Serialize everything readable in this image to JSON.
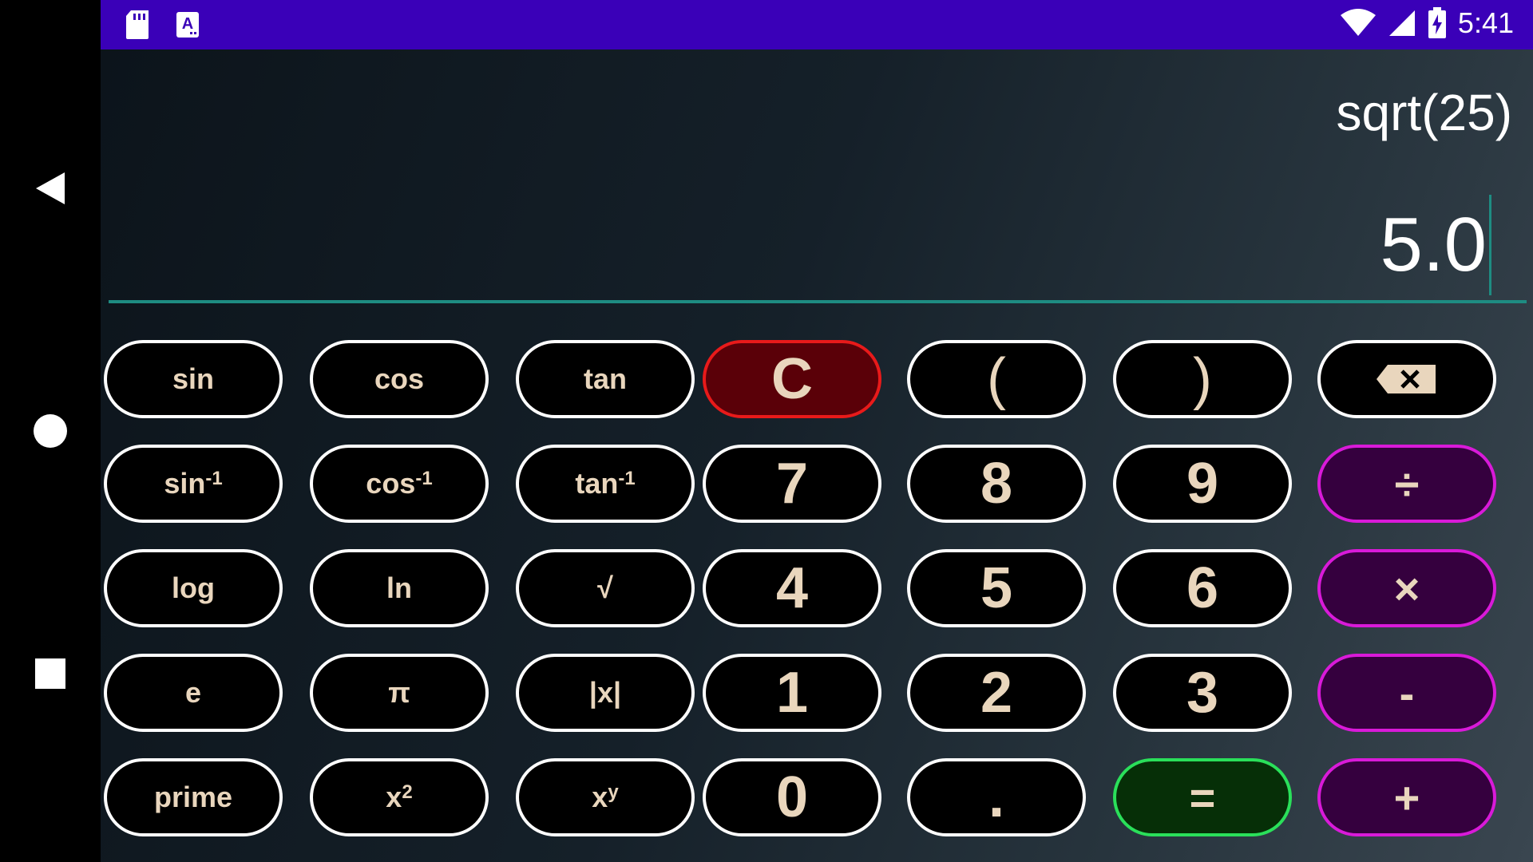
{
  "status_bar": {
    "time": "5:41",
    "icons": [
      "sd-card-icon",
      "keyboard-a-icon",
      "wifi-icon",
      "cell-signal-icon",
      "battery-charging-icon"
    ],
    "color": "#3a00b8"
  },
  "nav": {
    "icons": [
      "back-triangle-icon",
      "home-circle-icon",
      "recents-square-icon"
    ]
  },
  "display": {
    "expression": "sqrt(25)",
    "result": "5.0",
    "accent": "#1e8c82"
  },
  "keys": {
    "sin": "sin",
    "cos": "cos",
    "tan": "tan",
    "clear": "C",
    "lparen": "(",
    "rparen": ")",
    "backspace": "⌫",
    "asin": "sin",
    "asin_sup": "-1",
    "acos": "cos",
    "acos_sup": "-1",
    "atan": "tan",
    "atan_sup": "-1",
    "seven": "7",
    "eight": "8",
    "nine": "9",
    "divide": "÷",
    "log": "log",
    "ln": "ln",
    "sqrt": "√",
    "four": "4",
    "five": "5",
    "six": "6",
    "multiply": "×",
    "e": "e",
    "pi": "π",
    "abs": "|x|",
    "one": "1",
    "two": "2",
    "three": "3",
    "minus": "-",
    "prime": "prime",
    "square": "x",
    "square_sup": "2",
    "power": "x",
    "power_sup": "y",
    "zero": "0",
    "dot": ".",
    "equals": "=",
    "plus": "+"
  }
}
